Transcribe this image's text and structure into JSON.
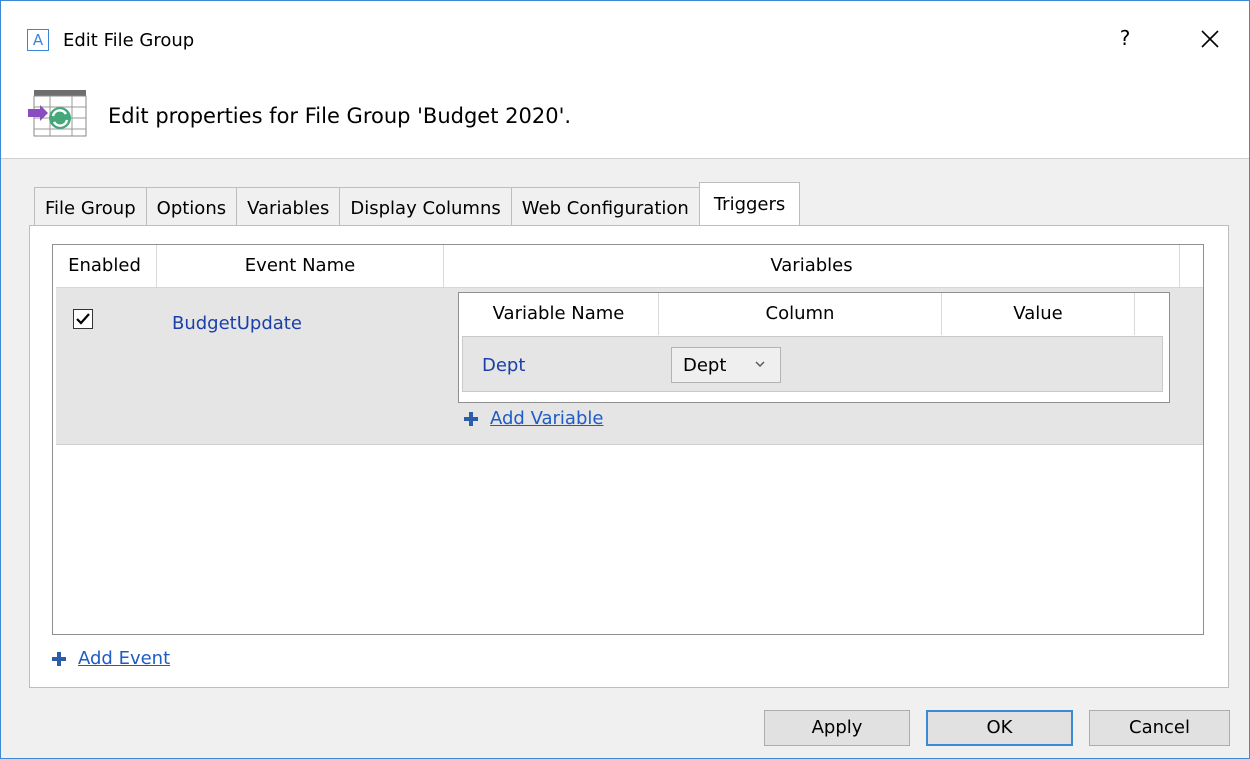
{
  "window": {
    "app_icon_letter": "A",
    "title": "Edit File Group",
    "help_label": "?"
  },
  "header": {
    "icon": "file-group-sync-icon",
    "text": "Edit properties for File Group 'Budget 2020'."
  },
  "tabs": [
    {
      "label": "File Group",
      "active": false
    },
    {
      "label": "Options",
      "active": false
    },
    {
      "label": "Variables",
      "active": false
    },
    {
      "label": "Display Columns",
      "active": false
    },
    {
      "label": "Web Configuration",
      "active": false
    },
    {
      "label": "Triggers",
      "active": true
    }
  ],
  "events_grid": {
    "columns": [
      "Enabled",
      "Event Name",
      "Variables"
    ],
    "rows": [
      {
        "enabled": true,
        "event_name": "BudgetUpdate",
        "variables_grid": {
          "columns": [
            "Variable Name",
            "Column",
            "Value"
          ],
          "rows": [
            {
              "variable_name": "Dept",
              "column": "Dept",
              "value": ""
            }
          ]
        },
        "add_variable_label": "Add Variable"
      }
    ]
  },
  "add_event_label": "Add Event",
  "buttons": {
    "apply": "Apply",
    "ok": "OK",
    "cancel": "Cancel"
  },
  "colors": {
    "accent": "#3c8ad4",
    "link": "#1e5bc6",
    "row_bg": "#e5e5e5"
  }
}
